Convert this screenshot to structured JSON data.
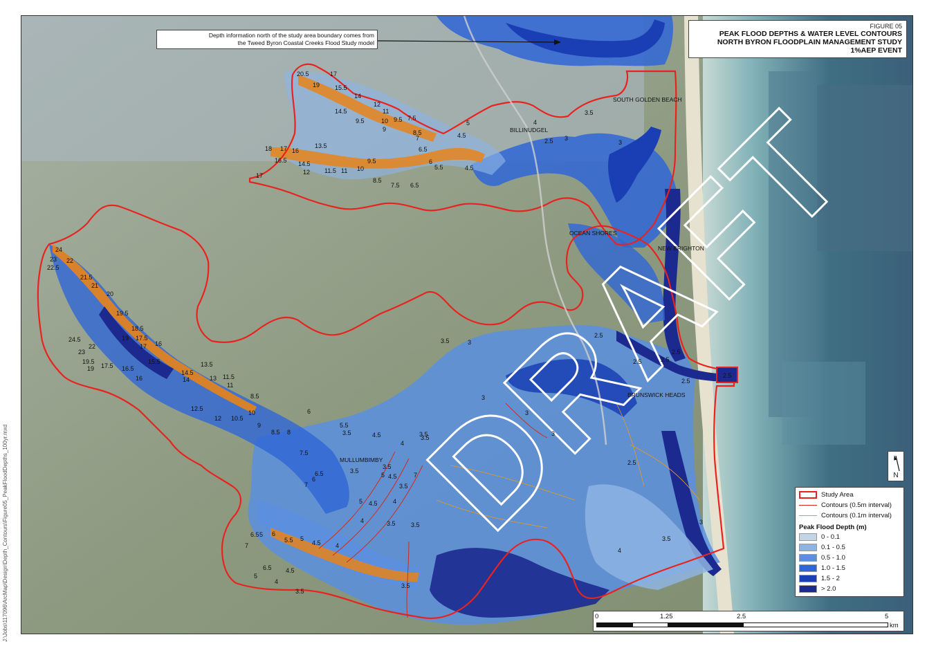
{
  "title": {
    "figure": "FIGURE 05",
    "line1": "PEAK FLOOD DEPTHS & WATER LEVEL CONTOURS",
    "line2": "NORTH BYRON FLOODPLAIN MANAGEMENT STUDY",
    "line3": "1%AEP EVENT"
  },
  "note": {
    "line1": "Depth information north of the study area boundary comes from",
    "line2": "the Tweed Byron Coastal Creeks Flood Study model"
  },
  "watermark": "DRAFT",
  "places": {
    "south_golden_beach": "SOUTH GOLDEN BEACH",
    "billinudgel": "BILLINUDGEL",
    "ocean_shores": "OCEAN SHORES",
    "new_brighton": "NEW BRIGHTON",
    "brunswick_heads": "BRUNSWICK HEADS",
    "mullumbimby": "MULLUMBIMBY"
  },
  "contour_labels": {
    "l01": "20.5",
    "l02": "17",
    "l03": "19",
    "l04": "15.5",
    "l05": "14",
    "l06": "12",
    "l07": "14.5",
    "l08": "11",
    "l09": "9.5",
    "l10": "10",
    "l11": "9.5",
    "l12": "7.5",
    "l13": "8.5",
    "l14": "9",
    "l15": "7",
    "l16": "4.5",
    "l17": "5",
    "l18": "4",
    "l19": "3.5",
    "l20": "18",
    "l21": "17",
    "l22": "16",
    "l23": "13.5",
    "l24": "16.5",
    "l25": "14.5",
    "l26": "12",
    "l27": "11.5",
    "l28": "11",
    "l29": "10",
    "l30": "9.5",
    "l31": "6.5",
    "l32": "6",
    "l33": "5.5",
    "l34": "4.5",
    "l35": "8.5",
    "l36": "7.5",
    "l37": "6.5",
    "l38": "17",
    "l39": "2.5",
    "l40": "3",
    "l41": "3",
    "l42": "24",
    "l43": "23",
    "l44": "22",
    "l45": "22.5",
    "l46": "21.5",
    "l47": "21",
    "l48": "20",
    "l49": "19.5",
    "l50": "18.5",
    "l51": "19",
    "l52": "17.5",
    "l53": "17",
    "l54": "16",
    "l55": "24.5",
    "l56": "23",
    "l57": "22",
    "l58": "19.5",
    "l59": "19",
    "l60": "17.5",
    "l61": "16.5",
    "l62": "16",
    "l63": "15.5",
    "l64": "14.5",
    "l65": "14",
    "l66": "13.5",
    "l67": "13",
    "l68": "11.5",
    "l69": "11",
    "l70": "8.5",
    "l71": "12.5",
    "l72": "12",
    "l73": "10.5",
    "l74": "10",
    "l75": "9",
    "l76": "8.5",
    "l77": "8",
    "l78": "6",
    "l79": "5.5",
    "l80": "4.5",
    "l81": "4",
    "l82": "3.5",
    "l83": "3.5",
    "l84": "7.5",
    "l85": "6",
    "l86": "6.5",
    "l87": "7",
    "l88": "3.5",
    "l89": "5",
    "l90": "4.5",
    "l91": "3.5",
    "l92": "5",
    "l93": "4.5",
    "l94": "4",
    "l95": "4",
    "l96": "6.5",
    "l97": "5",
    "l98": "6",
    "l99": "7",
    "m01": "5.5",
    "m02": "5",
    "m03": "4.5",
    "m04": "4",
    "m05": "6.5",
    "m06": "5",
    "m07": "4.5",
    "m08": "4",
    "m09": "3.5",
    "m10": "3.5",
    "m11": "3.5",
    "m12": "3",
    "m13": "3",
    "m14": "3",
    "m15": "2.5",
    "m16": "2.5",
    "m17": "2.5",
    "m18": "2.5",
    "m19": "2.5",
    "m20": "2.5",
    "m21": "3.5",
    "m22": "3",
    "m23": "3.5",
    "m24": "4",
    "m25": "7",
    "m26": "2.5",
    "m27": "3",
    "m28": "3.5",
    "m29": "3.5",
    "m30": "3.5"
  },
  "legend": {
    "study_area": "Study Area",
    "contour_05": "Contours (0.5m interval)",
    "contour_01": "Contours (0.1m interval)",
    "depth_title": "Peak Flood Depth (m)",
    "classes": [
      {
        "label": "0 - 0.1",
        "color": "#c3d4e6"
      },
      {
        "label": "0.1 - 0.5",
        "color": "#8eb4e3"
      },
      {
        "label": "0.5 - 1.0",
        "color": "#5b8fe0"
      },
      {
        "label": "1.0 - 1.5",
        "color": "#2f66d6"
      },
      {
        "label": "1.5 - 2",
        "color": "#1a3fb5"
      },
      {
        "label": "> 2.0",
        "color": "#1c2a8f"
      }
    ],
    "study_area_color": "#e8231f",
    "contour_05_color": "#d42a1a",
    "contour_01_color": "#e89a1a"
  },
  "north_arrow": {
    "letter": "N"
  },
  "scale": {
    "t0": "0",
    "t1": "1.25",
    "t2": "2.5",
    "t3": "5",
    "unit": "km"
  },
  "file_path": "J:\\Jobs\\117096\\ArcMap\\Design\\Depth_Contours\\Figure05_PeakFloodDepths_100yr.mxd"
}
